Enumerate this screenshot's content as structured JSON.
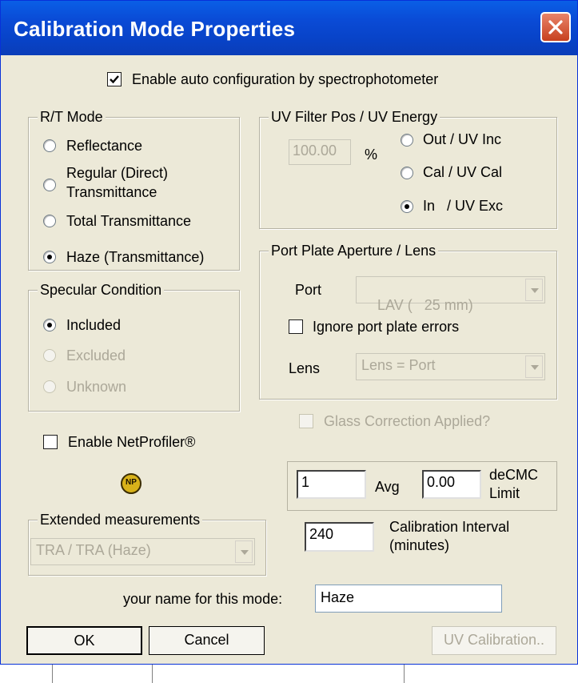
{
  "window": {
    "title": "Calibration Mode Properties"
  },
  "auto_config": {
    "label": "Enable auto configuration by spectrophotometer",
    "checked": true
  },
  "rt_mode": {
    "legend": "R/T Mode",
    "options": [
      {
        "label": "Reflectance",
        "selected": false
      },
      {
        "label_line1": "Regular  (Direct)",
        "label_line2": "Transmittance",
        "selected": false
      },
      {
        "label": "Total Transmittance",
        "selected": false
      },
      {
        "label": "Haze (Transmittance)",
        "selected": true
      }
    ]
  },
  "uv_filter": {
    "legend": "UV Filter Pos / UV Energy",
    "value": "100.00",
    "unit": "%",
    "options": [
      {
        "label": "Out / UV Inc",
        "selected": false
      },
      {
        "label": "Cal / UV Cal",
        "selected": false
      },
      {
        "label": "In   / UV Exc",
        "selected": true
      }
    ]
  },
  "specular": {
    "legend": "Specular Condition",
    "options": [
      {
        "label": "Included",
        "selected": true,
        "enabled": true
      },
      {
        "label": "Excluded",
        "selected": false,
        "enabled": false
      },
      {
        "label": "Unknown",
        "selected": false,
        "enabled": false
      }
    ]
  },
  "port_plate": {
    "legend": "Port Plate Aperture / Lens",
    "port_label": "Port",
    "port_value": "LAV (   25 mm)",
    "ignore_errors_label": "Ignore port plate errors",
    "ignore_errors_checked": false,
    "lens_label": "Lens",
    "lens_value": "Lens = Port"
  },
  "glass_correction": {
    "label": "Glass Correction Applied?",
    "checked": false,
    "enabled": false
  },
  "netprofiler": {
    "label": "Enable NetProfiler®",
    "checked": false,
    "icon_text": "NP"
  },
  "avg": {
    "value": "1",
    "label": "Avg"
  },
  "decmc": {
    "value": "0.00",
    "label_line1": "deCMC",
    "label_line2": "Limit"
  },
  "extended": {
    "legend": "Extended measurements",
    "value": "TRA / TRA (Haze)"
  },
  "calibration_interval": {
    "value": "240",
    "label_line1": "Calibration Interval",
    "label_line2": "(minutes)"
  },
  "mode_name": {
    "label": "your name for this mode:",
    "value": "Haze"
  },
  "buttons": {
    "ok": "OK",
    "cancel": "Cancel",
    "uv_calibration": "UV Calibration.."
  },
  "colors": {
    "titlebar": "#0a4bd6",
    "dialog_bg": "#ece9d8",
    "close_button": "#d5512e",
    "disabled_text": "#aca899"
  }
}
